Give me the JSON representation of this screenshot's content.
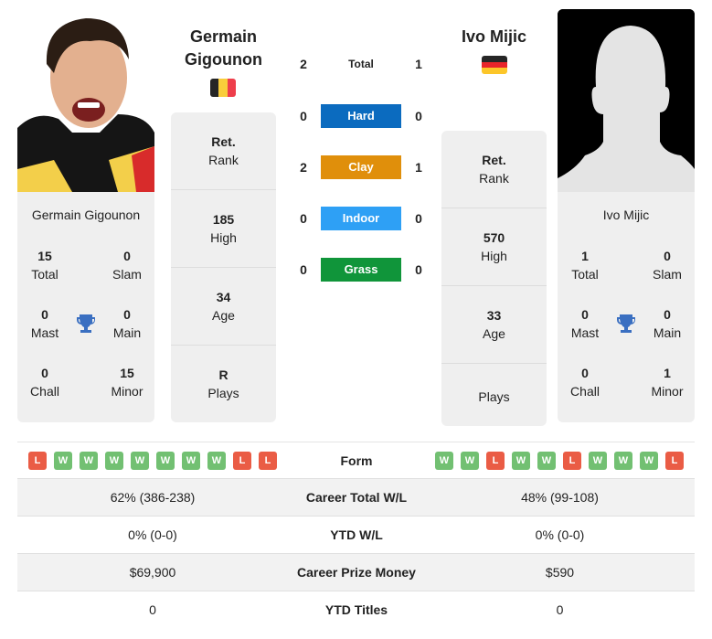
{
  "player1": {
    "name_line1": "Germain",
    "name_line2": "Gigounon",
    "full_name": "Germain Gigounon",
    "flag": "belgium-flag",
    "flag_colors": [
      "#262626",
      "#f9cd3b",
      "#ee3e4b"
    ],
    "titles": {
      "total": {
        "value": "15",
        "label": "Total"
      },
      "slam": {
        "value": "0",
        "label": "Slam"
      },
      "mast": {
        "value": "0",
        "label": "Mast"
      },
      "main": {
        "value": "0",
        "label": "Main"
      },
      "chall": {
        "value": "0",
        "label": "Chall"
      },
      "minor": {
        "value": "15",
        "label": "Minor"
      }
    },
    "stats": {
      "rank": {
        "value": "Ret.",
        "label": "Rank"
      },
      "high": {
        "value": "185",
        "label": "High"
      },
      "age": {
        "value": "34",
        "label": "Age"
      },
      "plays": {
        "value": "R",
        "label": "Plays"
      }
    },
    "form": [
      "L",
      "W",
      "W",
      "W",
      "W",
      "W",
      "W",
      "W",
      "L",
      "L"
    ]
  },
  "player2": {
    "name_line1": "Ivo Mijic",
    "full_name": "Ivo Mijic",
    "flag": "germany-flag",
    "flag_colors": [
      "#262626",
      "#e8242a",
      "#fcc629"
    ],
    "titles": {
      "total": {
        "value": "1",
        "label": "Total"
      },
      "slam": {
        "value": "0",
        "label": "Slam"
      },
      "mast": {
        "value": "0",
        "label": "Mast"
      },
      "main": {
        "value": "0",
        "label": "Main"
      },
      "chall": {
        "value": "0",
        "label": "Chall"
      },
      "minor": {
        "value": "1",
        "label": "Minor"
      }
    },
    "stats": {
      "rank": {
        "value": "Ret.",
        "label": "Rank"
      },
      "high": {
        "value": "570",
        "label": "High"
      },
      "age": {
        "value": "33",
        "label": "Age"
      },
      "plays": {
        "value": "",
        "label": "Plays"
      }
    },
    "form": [
      "W",
      "W",
      "L",
      "W",
      "W",
      "L",
      "W",
      "W",
      "W",
      "L"
    ]
  },
  "h2h": [
    {
      "label": "Total",
      "p1": "2",
      "p2": "1",
      "color": null
    },
    {
      "label": "Hard",
      "p1": "0",
      "p2": "0",
      "color": "#0b6bbf"
    },
    {
      "label": "Clay",
      "p1": "2",
      "p2": "1",
      "color": "#e08f0b"
    },
    {
      "label": "Indoor",
      "p1": "0",
      "p2": "0",
      "color": "#2ea0f5"
    },
    {
      "label": "Grass",
      "p1": "0",
      "p2": "0",
      "color": "#10953a"
    }
  ],
  "table": {
    "form_label": "Form",
    "rows": [
      {
        "label": "Career Total W/L",
        "p1": "62% (386-238)",
        "p2": "48% (99-108)"
      },
      {
        "label": "YTD W/L",
        "p1": "0% (0-0)",
        "p2": "0% (0-0)"
      },
      {
        "label": "Career Prize Money",
        "p1": "$69,900",
        "p2": "$590"
      },
      {
        "label": "YTD Titles",
        "p1": "0",
        "p2": "0"
      }
    ]
  },
  "colors": {
    "win": "#72c072",
    "loss": "#ea5c45",
    "trophy": "#3a6fc1",
    "card_bg": "#efefef"
  }
}
